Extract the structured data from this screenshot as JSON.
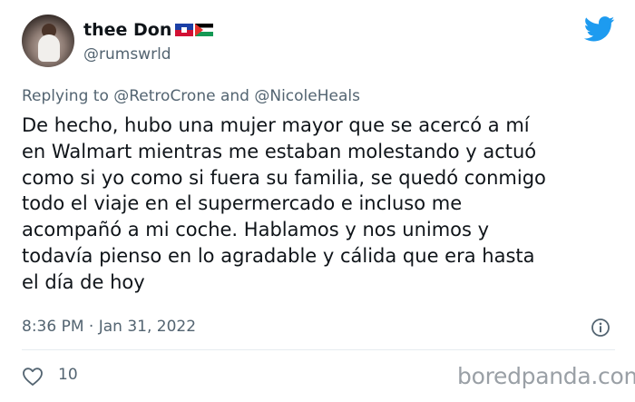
{
  "author": {
    "display_name": "thee Don",
    "handle": "@rumswrld",
    "flags": [
      "haiti-flag",
      "palestine-flag"
    ]
  },
  "reply": {
    "prefix": "Replying to",
    "mention_1": "@RetroCrone",
    "joiner": "and",
    "mention_2": "@NicoleHeals"
  },
  "tweet": {
    "text": "De hecho, hubo una mujer mayor que se acercó a mí\nen Walmart mientras me estaban molestando y actuó\ncomo si yo como si fuera su familia, se quedó conmigo\ntodo el viaje en el supermercado e incluso me\nacompañó a mi coche. Hablamos y nos unimos y\ntodavía pienso en lo agradable y cálida que era hasta\nel día de hoy",
    "timestamp": "8:36 PM · Jan 31, 2022",
    "likes": "10"
  },
  "icons": {
    "brand": "twitter-bird-icon",
    "info": "info-icon",
    "like": "heart-icon"
  },
  "watermark": "boredpanda.com",
  "colors": {
    "twitter_blue": "#1d9bf0",
    "secondary_text": "#536471",
    "primary_text": "#0f1419"
  }
}
